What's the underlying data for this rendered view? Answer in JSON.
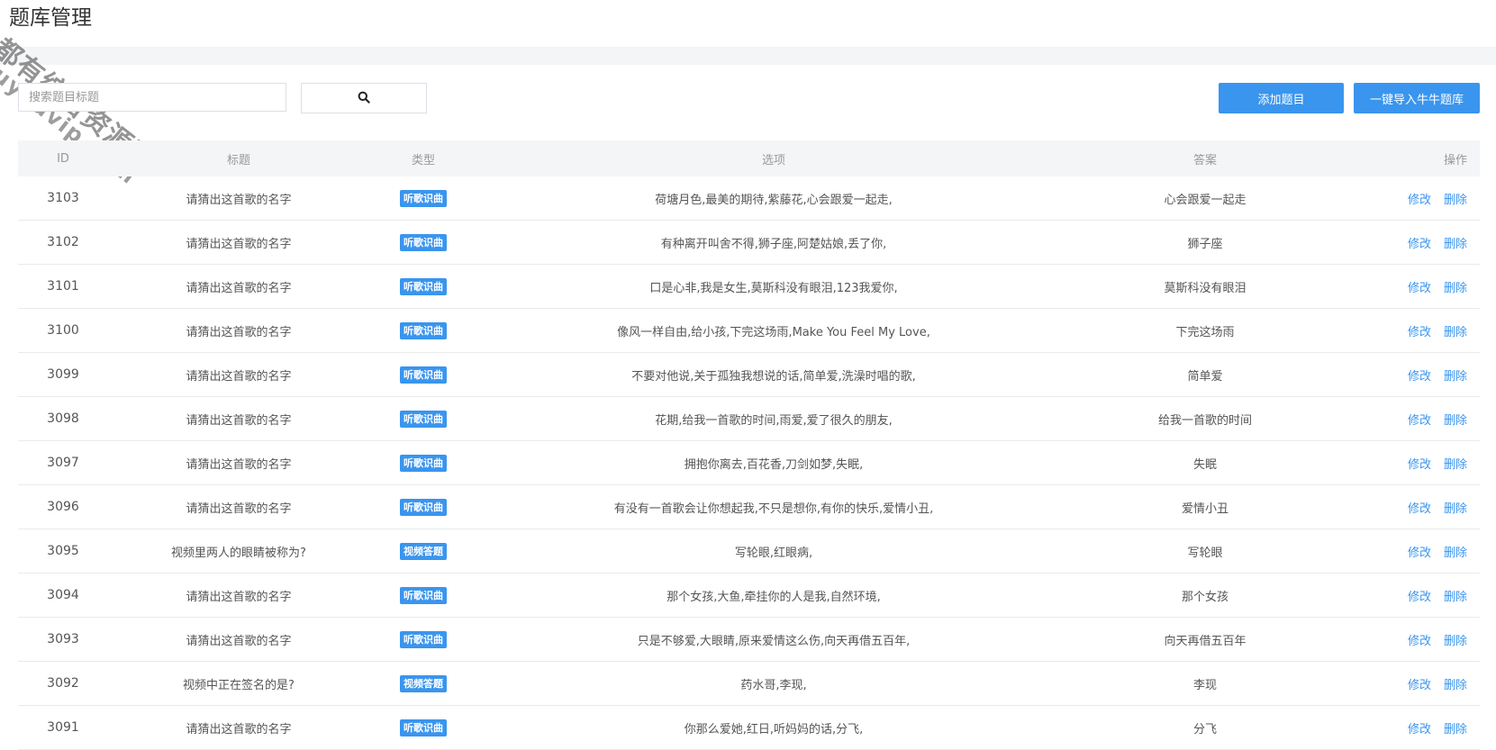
{
  "page": {
    "title": "题库管理"
  },
  "watermark": {
    "line1": "都有综合资源网",
    "line2": "douyouvip.com"
  },
  "toolbar": {
    "search_placeholder": "搜索题目标题",
    "search_icon": "search-icon",
    "add_label": "添加题目",
    "import_label": "一键导入牛牛题库"
  },
  "colors": {
    "accent": "#3a95ee",
    "header_bg": "#f4f5f7"
  },
  "table": {
    "headers": {
      "id": "ID",
      "title": "标题",
      "type": "类型",
      "options": "选项",
      "answer": "答案",
      "ops": "操作"
    },
    "edit_label": "修改",
    "delete_label": "删除",
    "rows": [
      {
        "id": "3103",
        "title": "请猜出这首歌的名字",
        "type": "听歌识曲",
        "options": "荷塘月色,最美的期待,紫藤花,心会跟爱一起走,",
        "answer": "心会跟爱一起走"
      },
      {
        "id": "3102",
        "title": "请猜出这首歌的名字",
        "type": "听歌识曲",
        "options": "有种离开叫舍不得,狮子座,阿楚姑娘,丢了你,",
        "answer": "狮子座"
      },
      {
        "id": "3101",
        "title": "请猜出这首歌的名字",
        "type": "听歌识曲",
        "options": "口是心非,我是女生,莫斯科没有眼泪,123我爱你,",
        "answer": "莫斯科没有眼泪"
      },
      {
        "id": "3100",
        "title": "请猜出这首歌的名字",
        "type": "听歌识曲",
        "options": "像风一样自由,给小孩,下完这场雨,Make You Feel My Love,",
        "answer": "下完这场雨"
      },
      {
        "id": "3099",
        "title": "请猜出这首歌的名字",
        "type": "听歌识曲",
        "options": "不要对他说,关于孤独我想说的话,简单爱,洗澡时唱的歌,",
        "answer": "简单爱"
      },
      {
        "id": "3098",
        "title": "请猜出这首歌的名字",
        "type": "听歌识曲",
        "options": "花期,给我一首歌的时间,雨爱,爱了很久的朋友,",
        "answer": "给我一首歌的时间"
      },
      {
        "id": "3097",
        "title": "请猜出这首歌的名字",
        "type": "听歌识曲",
        "options": "拥抱你离去,百花香,刀剑如梦,失眠,",
        "answer": "失眠"
      },
      {
        "id": "3096",
        "title": "请猜出这首歌的名字",
        "type": "听歌识曲",
        "options": "有没有一首歌会让你想起我,不只是想你,有你的快乐,爱情小丑,",
        "answer": "爱情小丑"
      },
      {
        "id": "3095",
        "title": "视频里两人的眼睛被称为?",
        "type": "视频答题",
        "options": "写轮眼,红眼病,",
        "answer": "写轮眼"
      },
      {
        "id": "3094",
        "title": "请猜出这首歌的名字",
        "type": "听歌识曲",
        "options": "那个女孩,大鱼,牵挂你的人是我,自然环境,",
        "answer": "那个女孩"
      },
      {
        "id": "3093",
        "title": "请猜出这首歌的名字",
        "type": "听歌识曲",
        "options": "只是不够爱,大眼睛,原来爱情这么伤,向天再借五百年,",
        "answer": "向天再借五百年"
      },
      {
        "id": "3092",
        "title": "视频中正在签名的是?",
        "type": "视频答题",
        "options": "药水哥,李现,",
        "answer": "李现"
      },
      {
        "id": "3091",
        "title": "请猜出这首歌的名字",
        "type": "听歌识曲",
        "options": "你那么爱她,红日,听妈妈的话,分飞,",
        "answer": "分飞"
      }
    ]
  }
}
